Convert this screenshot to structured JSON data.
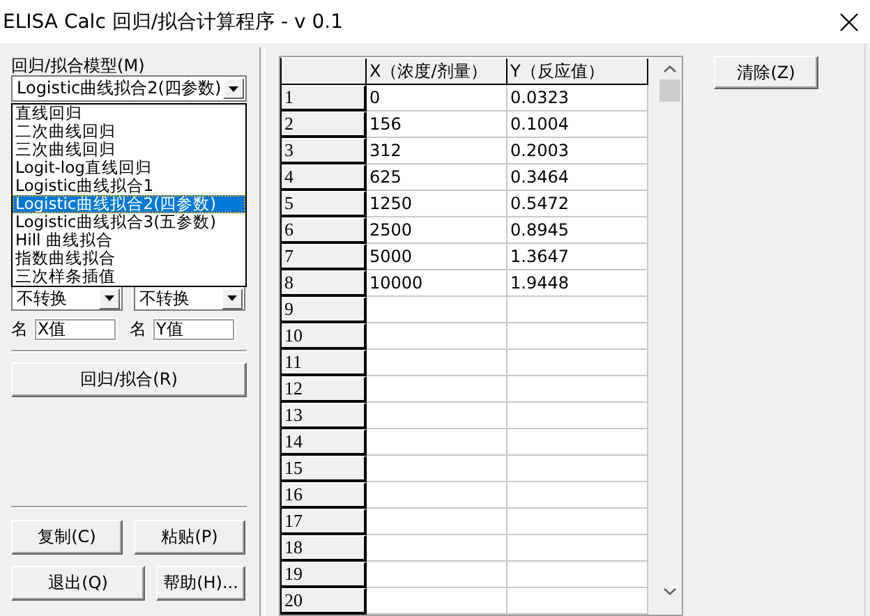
{
  "window": {
    "title": "ELISA Calc 回归/拟合计算程序 - v 0.1"
  },
  "model": {
    "label": "回归/拟合模型(M)",
    "value": "Logistic曲线拟合2(四参数)",
    "expanded": true,
    "options": [
      {
        "label": "直线回归",
        "selected": false
      },
      {
        "label": "二次曲线回归",
        "selected": false
      },
      {
        "label": "三次曲线回归",
        "selected": false
      },
      {
        "label": "Logit-log直线回归",
        "selected": false
      },
      {
        "label": "Logistic曲线拟合1",
        "selected": false
      },
      {
        "label": "Logistic曲线拟合2(四参数)",
        "selected": true
      },
      {
        "label": "Logistic曲线拟合3(五参数)",
        "selected": false
      },
      {
        "label": "Hill 曲线拟合",
        "selected": false
      },
      {
        "label": "指数曲线拟合",
        "selected": false
      },
      {
        "label": "三次样条插值",
        "selected": false
      }
    ]
  },
  "transforms": [
    {
      "value": "不转换"
    },
    {
      "value": "不转换"
    }
  ],
  "names": [
    {
      "label": "名",
      "value": "X值"
    },
    {
      "label": "名",
      "value": "Y值"
    }
  ],
  "fit_button": "回归/拟合(R)",
  "buttons": [
    "复制(C)",
    "粘贴(P)",
    "退出(Q)",
    "帮助(H)..."
  ],
  "clear_button": "清除(Z)",
  "table": {
    "columns": [
      "X（浓度/剂量）",
      "Y（反应值）"
    ],
    "rows": [
      {
        "header": "1",
        "cells": [
          "0",
          "0.0323"
        ]
      },
      {
        "header": "2",
        "cells": [
          "156",
          "0.1004"
        ]
      },
      {
        "header": "3",
        "cells": [
          "312",
          "0.2003"
        ]
      },
      {
        "header": "4",
        "cells": [
          "625",
          "0.3464"
        ]
      },
      {
        "header": "5",
        "cells": [
          "1250",
          "0.5472"
        ]
      },
      {
        "header": "6",
        "cells": [
          "2500",
          "0.8945"
        ]
      },
      {
        "header": "7",
        "cells": [
          "5000",
          "1.3647"
        ]
      },
      {
        "header": "8",
        "cells": [
          "10000",
          "1.9448"
        ]
      },
      {
        "header": "9"
      },
      {
        "header": "10"
      },
      {
        "header": "11"
      },
      {
        "header": "12"
      },
      {
        "header": "13"
      },
      {
        "header": "14"
      },
      {
        "header": "15"
      },
      {
        "header": "16"
      },
      {
        "header": "17"
      },
      {
        "header": "18"
      },
      {
        "header": "19"
      },
      {
        "header": "20"
      }
    ]
  }
}
